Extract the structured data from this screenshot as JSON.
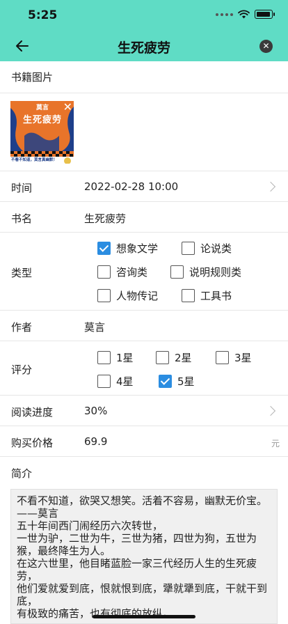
{
  "status_bar": {
    "time": "5:25"
  },
  "header": {
    "title": "生死疲劳",
    "back_icon": "arrow-left-icon",
    "close_icon": "close-circle-icon"
  },
  "book_image": {
    "label": "书籍图片",
    "cover_author": "莫言",
    "cover_title": "生死疲劳",
    "cover_tagline": "不看不知道，莫言真幽默！"
  },
  "time": {
    "label": "时间",
    "value": "2022-02-28 10:00"
  },
  "book_name": {
    "label": "书名",
    "value": "生死疲劳"
  },
  "type": {
    "label": "类型",
    "options": [
      {
        "label": "想象文学",
        "checked": true
      },
      {
        "label": "论说类",
        "checked": false
      },
      {
        "label": "咨询类",
        "checked": false
      },
      {
        "label": "说明规则类",
        "checked": false
      },
      {
        "label": "人物传记",
        "checked": false
      },
      {
        "label": "工具书",
        "checked": false
      }
    ]
  },
  "author": {
    "label": "作者",
    "value": "莫言"
  },
  "rating": {
    "label": "评分",
    "options": [
      {
        "label": "1星",
        "checked": false
      },
      {
        "label": "2星",
        "checked": false
      },
      {
        "label": "3星",
        "checked": false
      },
      {
        "label": "4星",
        "checked": false
      },
      {
        "label": "5星",
        "checked": true
      }
    ]
  },
  "progress": {
    "label": "阅读进度",
    "value": "30%"
  },
  "price": {
    "label": "购买价格",
    "value": "69.9",
    "unit": "元"
  },
  "intro": {
    "label": "简介",
    "text": "不看不知道，欲哭又想笑。活着不容易，幽默无价宝。\n——莫言\n五十年间西门闹经历六次转世，\n一世为驴，二世为牛，三世为猪，四世为狗，五世为猴，最终降生为人。\n在这六世里，他目睹蓝脸一家三代经历人生的生死疲劳，\n他们爱就爱到底，恨就恨到底，犟就犟到底，干就干到底，\n有极致的痛苦，也有彻底的放纵。"
  },
  "colors": {
    "header_bg": "#5fdcc5",
    "checkbox_checked": "#2b8de1",
    "cover_orange": "#e8742a",
    "cover_blue": "#1e3f8a"
  }
}
